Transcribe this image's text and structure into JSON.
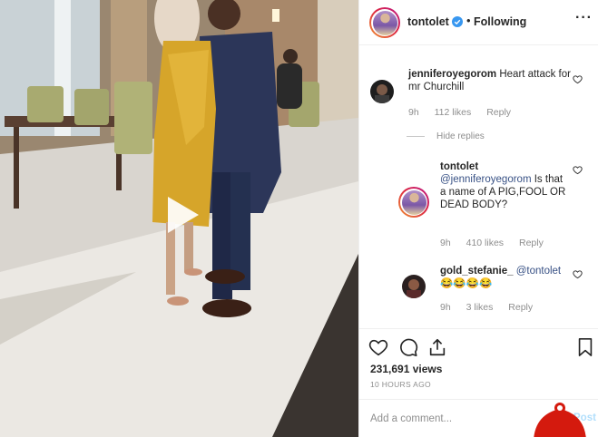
{
  "post": {
    "username": "tontolet",
    "verified": true,
    "separator": "•",
    "follow_status": "Following",
    "more": "···"
  },
  "comments": [
    {
      "user": "jenniferoyegorom",
      "text": "Heart attack for mr Churchill",
      "time": "9h",
      "likes": "112 likes",
      "reply_label": "Reply"
    }
  ],
  "hide_replies_label": "Hide replies",
  "replies": [
    {
      "user": "tontolet",
      "mention": "@jenniferoyegorom",
      "text": "Is that a name of A PIG,FOOL OR DEAD BODY?",
      "time": "9h",
      "likes": "410 likes",
      "reply_label": "Reply"
    },
    {
      "user": "gold_stefanie_",
      "mention": "@tontolet",
      "text": "😂😂😂😂",
      "time": "9h",
      "likes": "3 likes",
      "reply_label": "Reply"
    }
  ],
  "stats": {
    "views": "231,691 views",
    "posted": "10 HOURS AGO"
  },
  "add_comment": {
    "placeholder": "Add a comment...",
    "post_label": "Post"
  },
  "icons": {
    "like": "heart-icon",
    "comment": "comment-icon",
    "share": "share-icon",
    "save": "bookmark-icon",
    "play": "play-icon",
    "verified": "verified-badge-icon",
    "comment_like": "small-heart-icon"
  },
  "colors": {
    "link": "#385185",
    "muted": "#8e8e8e",
    "verified": "#3897f0",
    "post_disabled": "#b2dffc"
  }
}
